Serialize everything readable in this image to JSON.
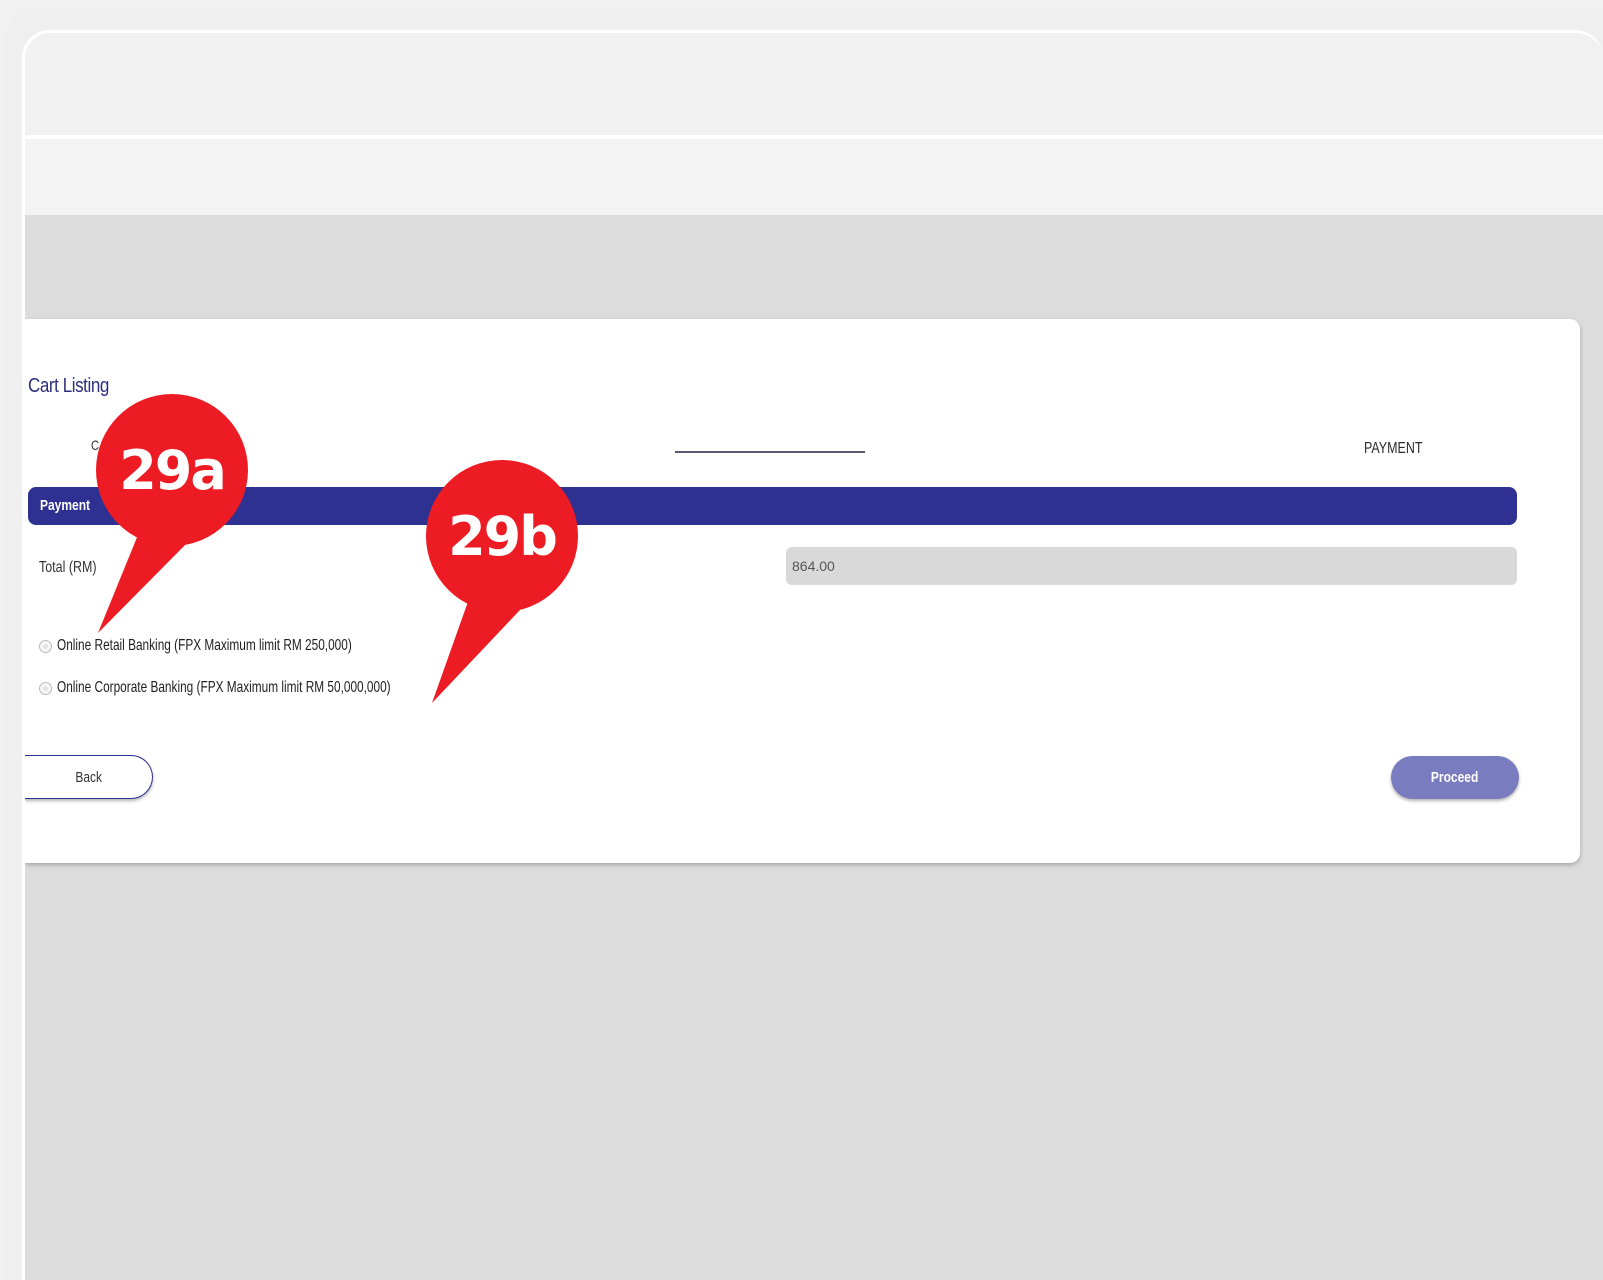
{
  "card": {
    "title": "Cart Listing",
    "steps": {
      "left_partial": "C",
      "right": "PAYMENT"
    }
  },
  "payment": {
    "section_label": "Payment",
    "total_label": "Total (RM)",
    "total_value": "864.00",
    "options": [
      {
        "label": "Online Retail Banking (FPX Maximum limit RM 250,000)",
        "selected": false
      },
      {
        "label": "Online Corporate Banking (FPX Maximum limit RM 50,000,000)",
        "selected": false
      }
    ]
  },
  "actions": {
    "back_label": "Back",
    "proceed_label": "Proceed"
  },
  "annotations": {
    "callout_a": "29a",
    "callout_b": "29b"
  },
  "colors": {
    "accent": "#2e3192",
    "proceed": "#7a7cc0",
    "callout": "#ed1c24"
  }
}
